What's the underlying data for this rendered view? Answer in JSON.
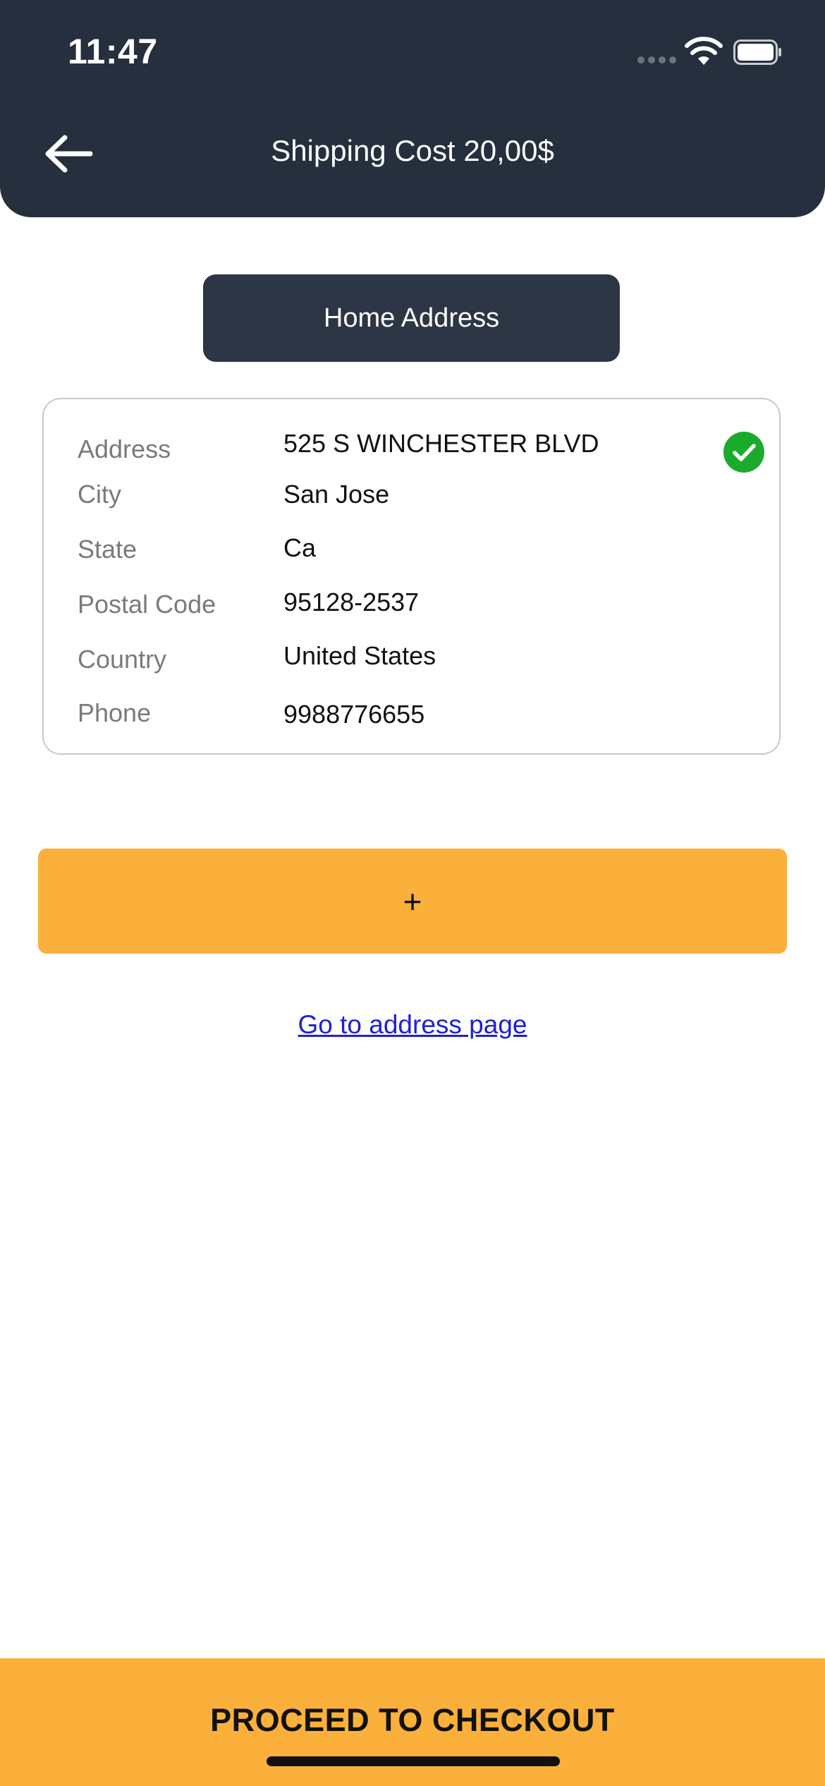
{
  "status_bar": {
    "time": "11:47"
  },
  "header": {
    "title": "Shipping Cost 20,00$",
    "back_icon": "arrow-left-icon"
  },
  "address_type_button": "Home Address",
  "address_card": {
    "selected": true,
    "selected_icon": "check-circle-icon",
    "rows": [
      {
        "label": "Address",
        "value": "525 S WINCHESTER BLVD"
      },
      {
        "label": "City",
        "value": "San Jose"
      },
      {
        "label": "State",
        "value": "Ca"
      },
      {
        "label": "Postal Code",
        "value": "95128-2537"
      },
      {
        "label": "Country",
        "value": "United States"
      },
      {
        "label": "Phone",
        "value": "9988776655"
      }
    ]
  },
  "add_button_label": "+",
  "address_page_link": "Go to address page",
  "checkout_button_label": "PROCEED TO CHECKOUT",
  "colors": {
    "header_bg": "#252f3e",
    "accent": "#fbb03b",
    "check_green": "#1bab2c",
    "link": "#1f1fd6"
  }
}
